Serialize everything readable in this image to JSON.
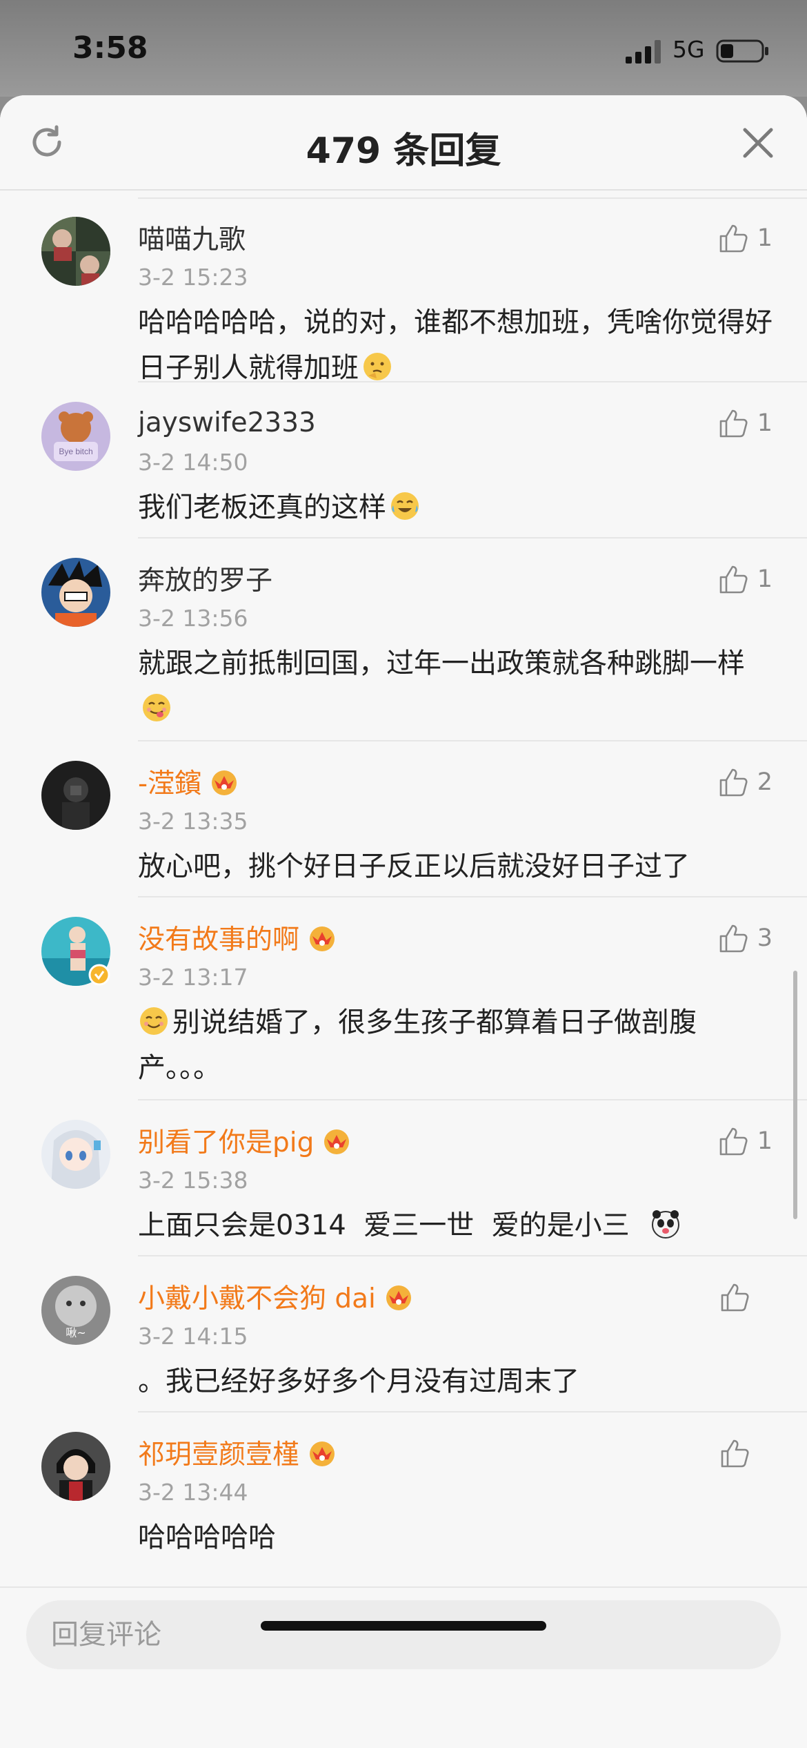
{
  "status_bar": {
    "time": "3:58",
    "network": "5G"
  },
  "header": {
    "title": "479 条回复"
  },
  "comments": [
    {
      "username": "喵喵九歌",
      "vip": false,
      "time": "3-2 15:23",
      "text": "哈哈哈哈哈，说的对，谁都不想加班，凭啥你觉得好日子别人就得加班",
      "emoji": "thinking-emoji",
      "likes": "1",
      "avatar_text": ""
    },
    {
      "username": "jayswife2333",
      "vip": false,
      "time": "3-2 14:50",
      "text": "我们老板还真的这样",
      "emoji": "laughing-crying-emoji",
      "likes": "1",
      "avatar_text": "Bye  bitch"
    },
    {
      "username": "奔放的罗子",
      "vip": false,
      "time": "3-2 13:56",
      "text": "就跟之前抵制回国，过年一出政策就各种跳脚一样",
      "emoji": "yum-emoji",
      "likes": "1",
      "avatar_text": ""
    },
    {
      "username": "-滢鑌",
      "vip": true,
      "time": "3-2 13:35",
      "text": "放心吧，挑个好日子反正以后就没好日子过了",
      "emoji": "",
      "likes": "2",
      "avatar_text": ""
    },
    {
      "username": "没有故事的啊",
      "vip": true,
      "time": "3-2 13:17",
      "text": "别说结婚了，很多生孩子都算着日子做剖腹产。。。",
      "emoji_prefix": "smile-emoji",
      "emoji": "",
      "likes": "3",
      "avatar_text": ""
    },
    {
      "username": "别看了你是pig",
      "vip": true,
      "time": "3-2 15:38",
      "text": "上面只会是0314  爱三一世  爱的是小三  ",
      "emoji": "panda-emoji",
      "likes": "1",
      "avatar_text": ""
    },
    {
      "username": "小戴小戴不会狗 dai",
      "vip": true,
      "time": "3-2 14:15",
      "text": "。我已经好多好多个月没有过周末了",
      "emoji": "",
      "likes": "",
      "avatar_text": "啾~"
    },
    {
      "username": "祁玥壹颜壹槿",
      "vip": true,
      "time": "3-2 13:44",
      "text": "哈哈哈哈哈",
      "emoji": "",
      "likes": "",
      "avatar_text": ""
    }
  ],
  "reply": {
    "placeholder": "回复评论"
  },
  "colors": {
    "vip_name": "#f27a1a",
    "background": "#f7f7f7",
    "timestamp": "#a2a2a2"
  }
}
